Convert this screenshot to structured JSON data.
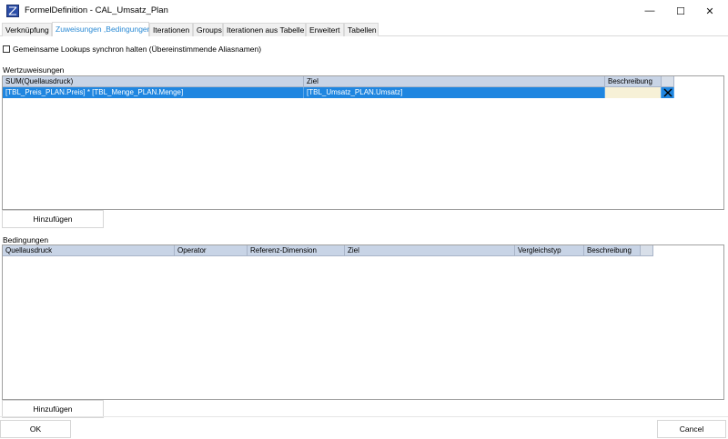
{
  "window": {
    "title": "FormelDefinition - CAL_Umsatz_Plan",
    "controls": {
      "minimize": "—",
      "maximize": "☐",
      "close": "✕"
    },
    "icon": "formula-window-icon"
  },
  "tabs": [
    {
      "label": "Verknüpfung",
      "active": false
    },
    {
      "label": "Zuweisungen ,Bedingungen",
      "active": true
    },
    {
      "label": "Iterationen",
      "active": false
    },
    {
      "label": "Groups",
      "active": false
    },
    {
      "label": "Iterationen aus Tabelle",
      "active": false
    },
    {
      "label": "Erweitert",
      "active": false
    },
    {
      "label": "Tabellen",
      "active": false
    }
  ],
  "sync_lookups": {
    "label": "Gemeinsame Lookups synchron halten (Übereinstimmende Aliasnamen)",
    "checked": false
  },
  "assignments": {
    "section_label": "Wertzuweisungen",
    "columns": [
      "SUM(Quellausdruck)",
      "Ziel",
      "Beschreibung"
    ],
    "rows": [
      {
        "source": "[TBL_Preis_PLAN.Preis] *  [TBL_Menge_PLAN.Menge]",
        "target": "[TBL_Umsatz_PLAN.Umsatz]",
        "description": ""
      }
    ],
    "add_label": "Hinzufügen"
  },
  "conditions": {
    "section_label": "Bedingungen",
    "columns": [
      "Quellausdruck",
      "Operator",
      "Referenz-Dimension",
      "Ziel",
      "Vergleichstyp",
      "Beschreibung"
    ],
    "rows": [],
    "add_label": "Hinzufügen"
  },
  "footer": {
    "ok_label": "OK",
    "cancel_label": "Cancel"
  },
  "colors": {
    "selected_row": "#1f86e0",
    "header": "#c8d4e6",
    "active_tab_text": "#2a8ad4",
    "description_cell": "#f7f1d7"
  }
}
